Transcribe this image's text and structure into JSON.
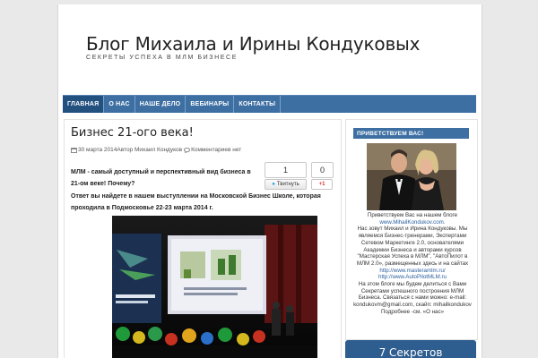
{
  "header": {
    "title": "Блог Михаила и Ирины Кондуковых",
    "description": "СЕКРЕТЫ УСПЕХА В МЛМ БИЗНЕСЕ"
  },
  "nav": {
    "items": [
      {
        "label": "ГЛАВНАЯ"
      },
      {
        "label": "О НАС"
      },
      {
        "label": "НАШЕ ДЕЛО"
      },
      {
        "label": "ВЕБИНАРЫ"
      },
      {
        "label": "КОНТАКТЫ"
      }
    ]
  },
  "post": {
    "title": "Бизнес 21-ого века!",
    "date": "30 марта 2014",
    "author": "Автор Михаил Кондуков",
    "comments": "Комментариев нет",
    "paragraph1": "МЛМ - самый доступный и перспективный вид бизнеса в 21-ом веке! Почему?",
    "paragraph2": "Ответ вы найдете в нашем выступлении на Московской Бизнес Школе, которая проходила в Подмосковье 22-23 марта 2014 г."
  },
  "share": {
    "count_left": "1",
    "count_right": "0",
    "tweet_label": "Твитнуть",
    "gplus_label": "+1"
  },
  "sidebar": {
    "widget_title": "ПРИВЕТСТВУЕМ ВАС!",
    "line1": "Приветствуем Вас на нашем блоге",
    "link1": "www.MihailKondukov.com.",
    "line2": "Нас зовут Михаил и Ирина Кондуковы. Мы являемся Бизнес-тренерами, Экспертами Сетевом Маркетинге 2.0, основателями Академии Бизнеса и авторами курсов \"Мастерская Успеха в МЛМ\", \"АвтоПилот в МЛМ 2.0», размещенных здесь и на сайтах",
    "link2": "http://www.masteramlm.ru/",
    "link3": "http://www.AutoPilotMLM.ru",
    "line3": "На этом блоге мы будем делиться с Вами Секретами успешного построения МЛМ Бизнеса. Связаться с нами можно: e-mail: kondukovm@gmail.com, скайп: mihailkondukov",
    "line4": "Подробнее -см. «О нас»",
    "bottom_widget_title": "7 Секретов"
  }
}
